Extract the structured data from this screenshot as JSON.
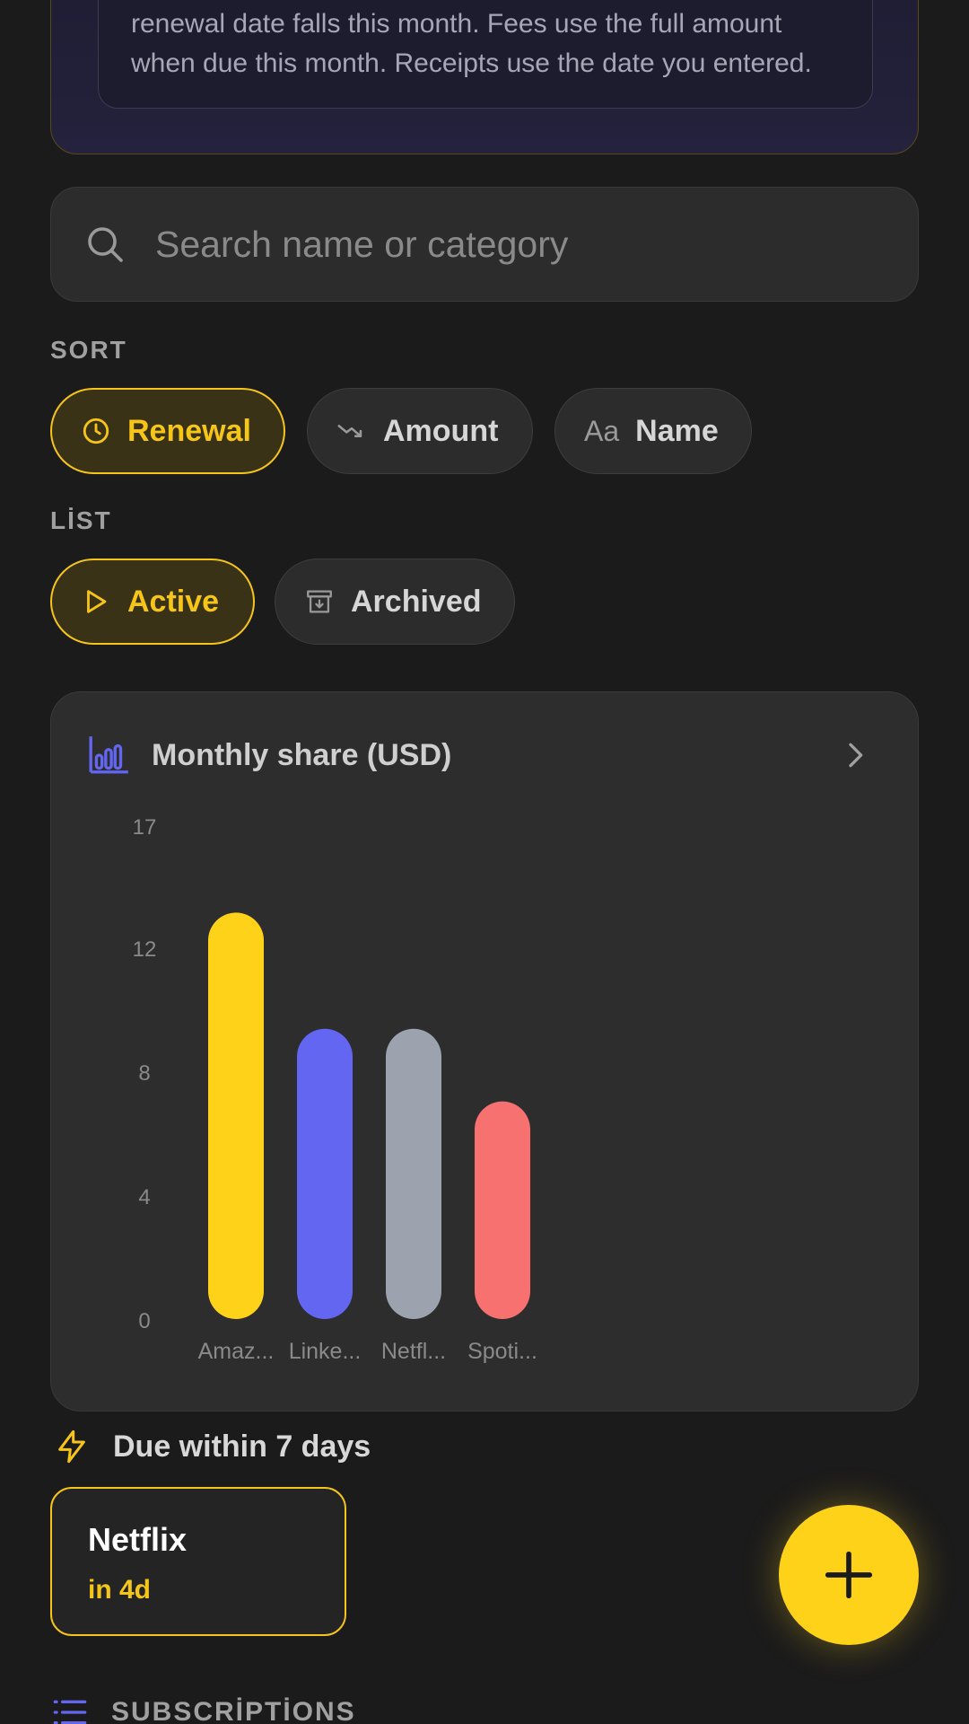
{
  "info_banner": {
    "line1": "renewal date falls this month. Fees use the full amount",
    "line2": "when due this month. Receipts use the date you entered."
  },
  "search": {
    "placeholder": "Search name or category",
    "value": ""
  },
  "sort": {
    "label": "SORT",
    "options": [
      {
        "label": "Renewal",
        "icon": "clock-icon",
        "active": true
      },
      {
        "label": "Amount",
        "icon": "trend-down-icon",
        "active": false
      },
      {
        "label": "Name",
        "icon": "text-aa-icon",
        "icon_text": "Aa",
        "active": false
      }
    ]
  },
  "list": {
    "label": "LİST",
    "options": [
      {
        "label": "Active",
        "icon": "play-icon",
        "active": true
      },
      {
        "label": "Archived",
        "icon": "archive-icon",
        "active": false
      }
    ]
  },
  "chart_card": {
    "title": "Monthly share (USD)",
    "icon": "bar-chart-icon"
  },
  "chart_data": {
    "type": "bar",
    "categories": [
      "Amaz...",
      "Linke...",
      "Netfl...",
      "Spoti..."
    ],
    "values": [
      13.99,
      9.99,
      9.99,
      7.49
    ],
    "colors": [
      "#ffd21a",
      "#6366f1",
      "#9ca3af",
      "#f87171"
    ],
    "y_ticks": [
      0,
      4,
      8,
      12,
      17
    ],
    "ylim": [
      0,
      17
    ],
    "grid": false,
    "legend": "none"
  },
  "due": {
    "title": "Due within 7 days",
    "icon": "lightning-icon",
    "items": [
      {
        "name": "Netflix",
        "when": "in 4d"
      }
    ]
  },
  "subscriptions": {
    "title": "SUBSCRİPTİONS",
    "icon": "list-icon"
  },
  "colors": {
    "accent": "#f5c518",
    "background": "#1b1b1b",
    "card": "#2d2d2d"
  }
}
